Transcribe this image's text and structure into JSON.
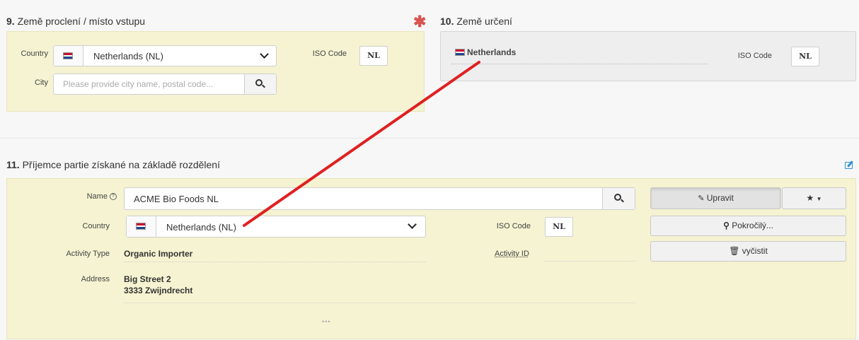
{
  "section9": {
    "number": "9.",
    "title": "Země proclení / místo vstupu",
    "country_label": "Country",
    "country_value": "Netherlands (NL)",
    "iso_label": "ISO Code",
    "iso_value": "NL",
    "city_label": "City",
    "city_placeholder": "Please provide city name, postal code..."
  },
  "section10": {
    "number": "10.",
    "title": "Země určení",
    "country_value": "Netherlands",
    "iso_label": "ISO Code",
    "iso_value": "NL"
  },
  "section11": {
    "number": "11.",
    "title": "Příjemce partie získané na základě rozdělení",
    "name_label": "Name",
    "name_value": "ACME Bio Foods NL",
    "country_label": "Country",
    "country_value": "Netherlands (NL)",
    "iso_label": "ISO Code",
    "iso_value": "NL",
    "activity_type_label": "Activity Type",
    "activity_type_value": "Organic Importer",
    "activity_id_label": "Activity ID",
    "activity_id_value": "",
    "address_label": "Address",
    "address_line1": "Big Street 2",
    "address_line2": "3333 Zwijndrecht",
    "more": "•••",
    "edit_button": "Upravit",
    "advanced_button": "Pokročilý...",
    "clear_button": "vyčistit"
  },
  "colors": {
    "panel_yellow": "#f5f3d1",
    "required_star": "#d9534f",
    "edit_icon": "#2f8fd8",
    "annotation_line": "#e02020"
  }
}
